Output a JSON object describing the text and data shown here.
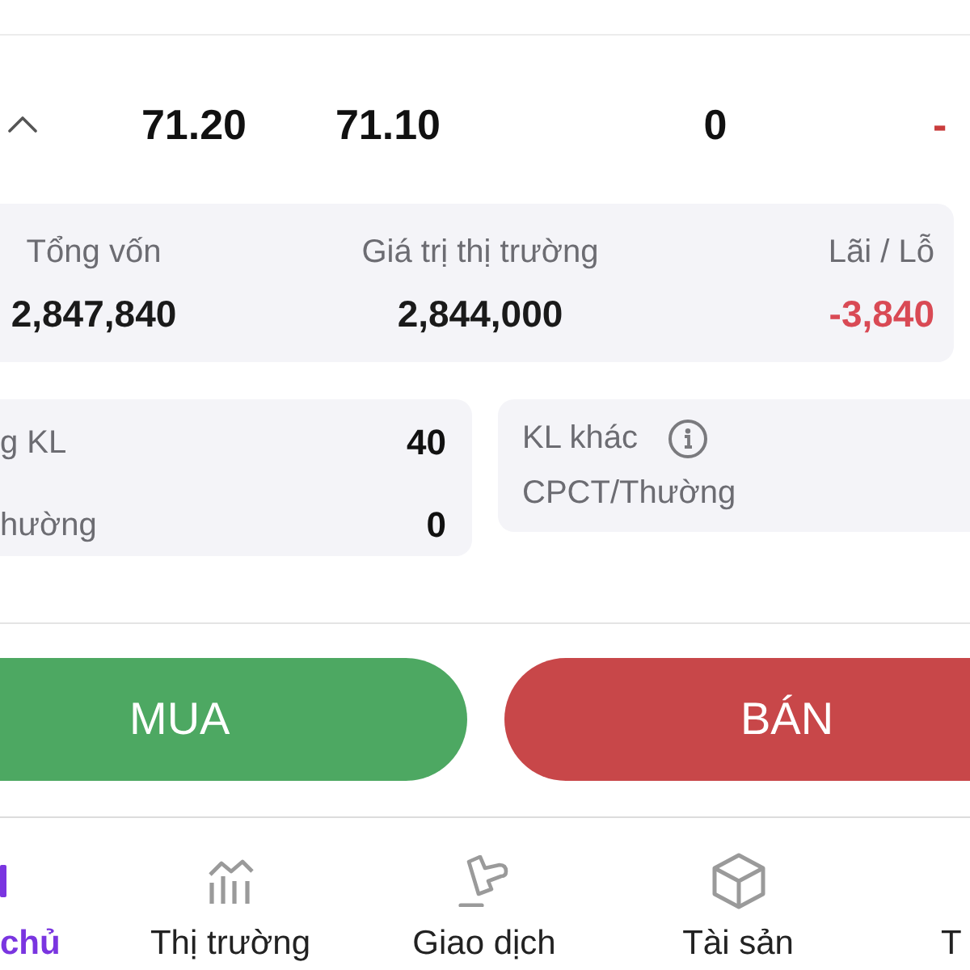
{
  "price_row": {
    "expanded": true,
    "cells": [
      {
        "text": "71.20",
        "negative": false
      },
      {
        "text": "71.10",
        "negative": false
      },
      {
        "text": "0",
        "negative": false
      },
      {
        "text": "-",
        "negative": true
      }
    ]
  },
  "summary": [
    {
      "label": "Tổng vốn",
      "value": "2,847,840",
      "negative": false
    },
    {
      "label": "Giá trị thị trường",
      "value": "2,844,000",
      "negative": false
    },
    {
      "label": "Lãi / Lỗ",
      "value": "-3,840",
      "negative": true
    }
  ],
  "volume_card": {
    "rows": [
      {
        "label": "g KL",
        "value": "40"
      },
      {
        "label": "hường",
        "value": "0"
      }
    ]
  },
  "other_volume_card": {
    "title": "KL khác",
    "subtitle": "CPCT/Thường"
  },
  "actions": [
    {
      "label": "MUA",
      "kind": "buy"
    },
    {
      "label": "BÁN",
      "kind": "sell"
    }
  ],
  "bottom_nav": [
    {
      "label": "chủ",
      "selected": true
    },
    {
      "label": "Thị trường",
      "selected": false
    },
    {
      "label": "Giao dịch",
      "selected": false
    },
    {
      "label": "Tài sản",
      "selected": false
    },
    {
      "label": "T",
      "selected": false
    }
  ]
}
